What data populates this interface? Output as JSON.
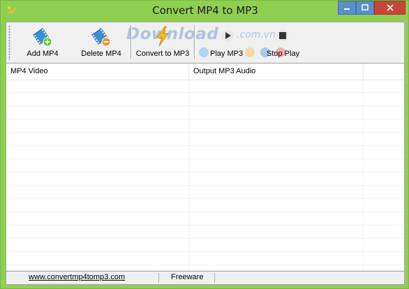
{
  "window": {
    "title": "Convert MP4 to MP3",
    "controls": {
      "minimize": "–",
      "maximize": "□",
      "close": "✕"
    }
  },
  "toolbar": {
    "add_label": "Add MP4",
    "delete_label": "Delete MP4",
    "convert_label": "Convert to MP3",
    "play_label": "Play MP3",
    "stop_label": "Stop Play"
  },
  "watermark": {
    "main": "Download",
    "sub": ".com.vn"
  },
  "list": {
    "columns": [
      "MP4 Video",
      "Output MP3 Audio"
    ]
  },
  "statusbar": {
    "link": "www.convertmp4tomp3.com",
    "license": "Freeware"
  },
  "colors": {
    "window_frame": "#8fcf52",
    "close_button": "#c7463a",
    "window_button": "#5b8fc9"
  }
}
